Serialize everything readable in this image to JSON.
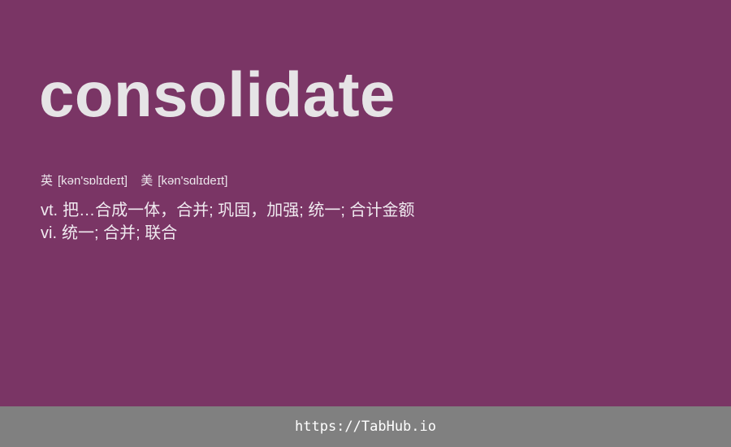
{
  "word": "consolidate",
  "phonetics": [
    {
      "region": "英",
      "ipa": "[kən'sɒlɪdeɪt]"
    },
    {
      "region": "美",
      "ipa": "[kən'sɑlɪdeɪt]"
    }
  ],
  "definitions": [
    {
      "pos": "vt.",
      "meaning": "把…合成一体，合并; 巩固，加强; 统一; 合计金额"
    },
    {
      "pos": "vi.",
      "meaning": "统一; 合并; 联合"
    }
  ],
  "footer": {
    "link": "https://TabHub.io"
  },
  "colors": {
    "background": "#7a3565",
    "footer_background": "#808080",
    "word_text": "#e6e4e6"
  }
}
